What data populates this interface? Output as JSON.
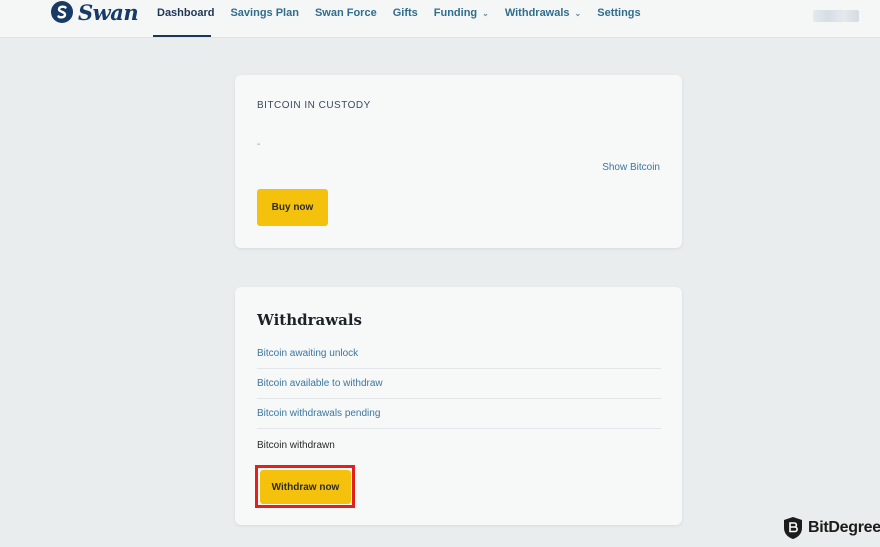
{
  "brand": {
    "name": "Swan"
  },
  "nav": {
    "items": [
      {
        "label": "Dashboard",
        "active": true,
        "dropdown": false
      },
      {
        "label": "Savings Plan",
        "active": false,
        "dropdown": false
      },
      {
        "label": "Swan Force",
        "active": false,
        "dropdown": false
      },
      {
        "label": "Gifts",
        "active": false,
        "dropdown": false
      },
      {
        "label": "Funding",
        "active": false,
        "dropdown": true
      },
      {
        "label": "Withdrawals",
        "active": false,
        "dropdown": true
      },
      {
        "label": "Settings",
        "active": false,
        "dropdown": false
      }
    ]
  },
  "custody": {
    "title": "BITCOIN IN CUSTODY",
    "value": "-",
    "show_link": "Show Bitcoin",
    "buy_label": "Buy now"
  },
  "withdrawals": {
    "title": "Withdrawals",
    "rows": [
      {
        "label": "Bitcoin awaiting unlock"
      },
      {
        "label": "Bitcoin available to withdraw"
      },
      {
        "label": "Bitcoin withdrawals pending"
      },
      {
        "label": "Bitcoin withdrawn"
      }
    ],
    "withdraw_label": "Withdraw now"
  },
  "colors": {
    "accent_yellow": "#f4c20d",
    "brand_navy": "#173a66",
    "link_blue": "#3a77a0",
    "highlight_red": "#e0211e"
  },
  "watermark": {
    "text": "BitDegree"
  }
}
